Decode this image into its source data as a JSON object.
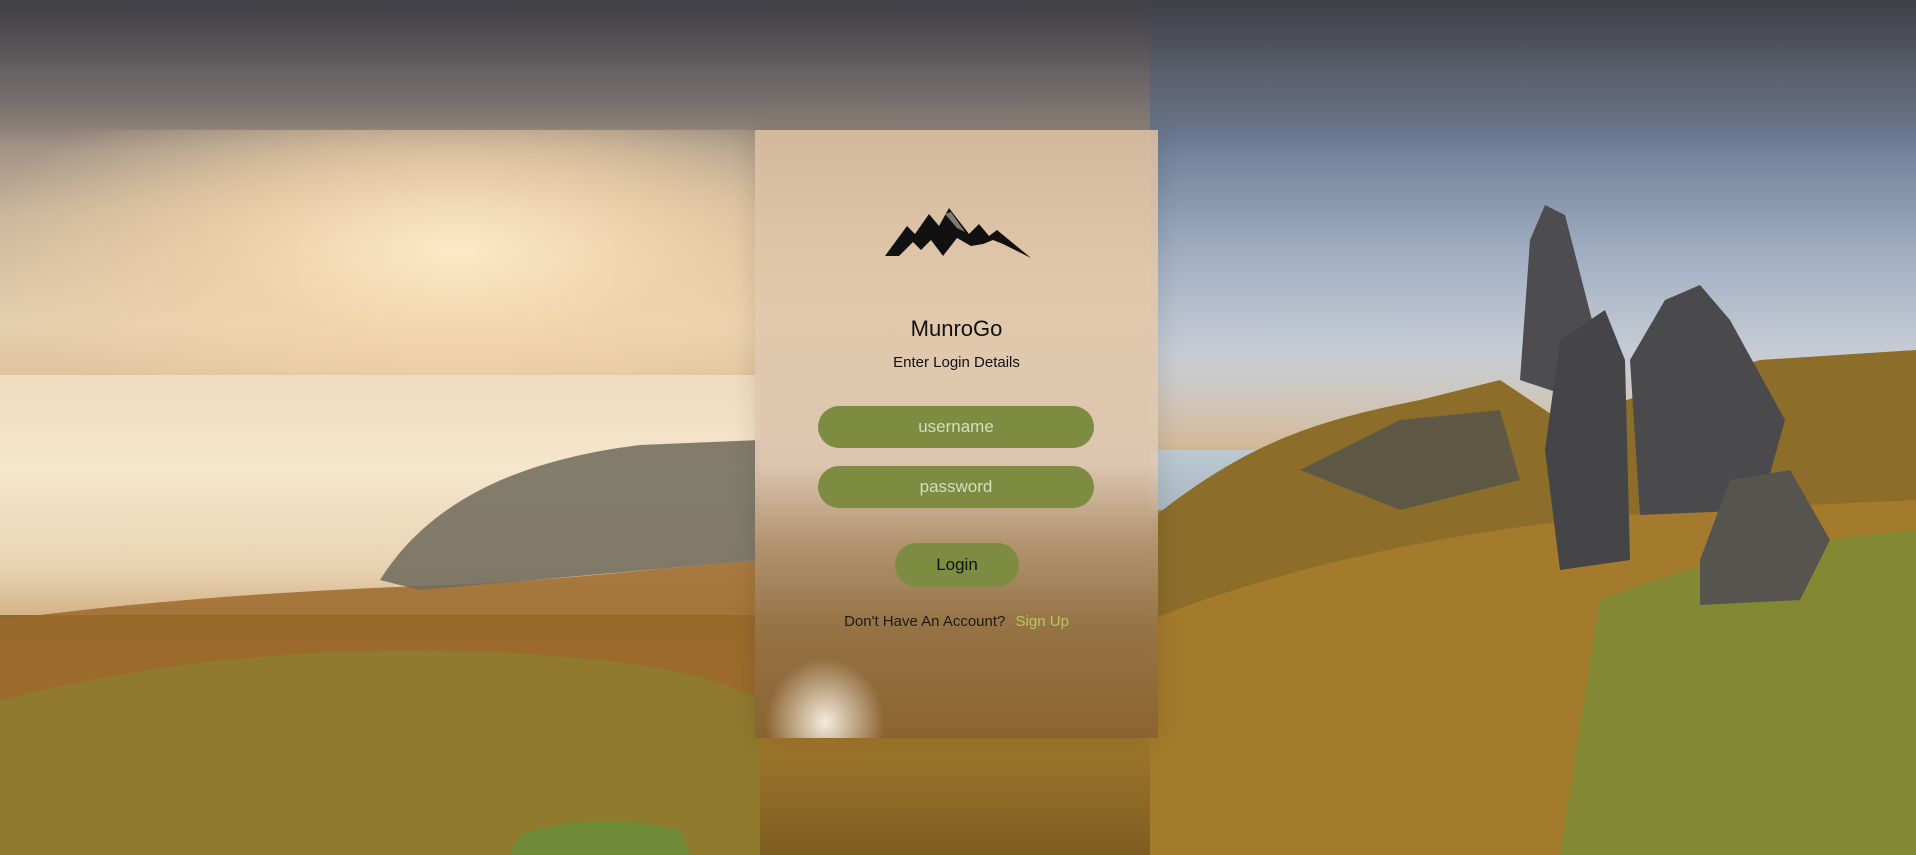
{
  "app": {
    "name": "MunroGo",
    "subtitle": "Enter Login Details"
  },
  "login_form": {
    "username_placeholder": "username",
    "password_placeholder": "password",
    "login_label": "Login",
    "signup_prompt": "Don't Have An Account?",
    "signup_link": "Sign Up"
  },
  "icons": {
    "logo": "mountain-logo-icon"
  },
  "colors": {
    "input_background": "#7d8c41",
    "button_background": "#7d8c41",
    "signup_link": "#b6c85a",
    "text": "#111111"
  }
}
